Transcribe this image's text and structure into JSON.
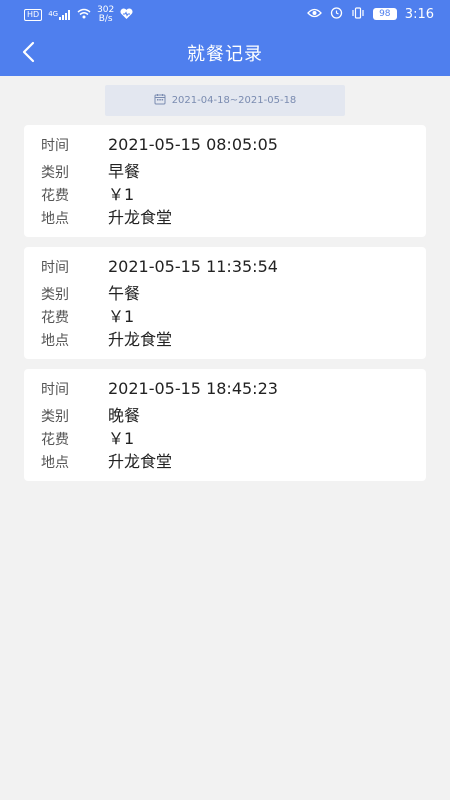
{
  "status_bar": {
    "left_badge": "HD",
    "signal": "4G",
    "net_speed_value": "302",
    "net_speed_unit": "B/s",
    "battery": "98",
    "time": "3:16"
  },
  "header": {
    "title": "就餐记录"
  },
  "filter": {
    "date_range": "2021-04-18~2021-05-18"
  },
  "records": [
    {
      "time_label": "时间",
      "time": "2021-05-15 08:05:05",
      "type_label": "类别",
      "type": "早餐",
      "cost_label": "花费",
      "cost": "￥1",
      "place_label": "地点",
      "place": "升龙食堂"
    },
    {
      "time_label": "时间",
      "time": "2021-05-15 11:35:54",
      "type_label": "类别",
      "type": "午餐",
      "cost_label": "花费",
      "cost": "￥1",
      "place_label": "地点",
      "place": "升龙食堂"
    },
    {
      "time_label": "时间",
      "time": "2021-05-15 18:45:23",
      "type_label": "类别",
      "type": "晚餐",
      "cost_label": "花费",
      "cost": "￥1",
      "place_label": "地点",
      "place": "升龙食堂"
    }
  ],
  "colors": {
    "header_bg": "#4f7fee",
    "page_bg": "#f2f2f2",
    "date_range_bg": "#e3e7f0"
  }
}
